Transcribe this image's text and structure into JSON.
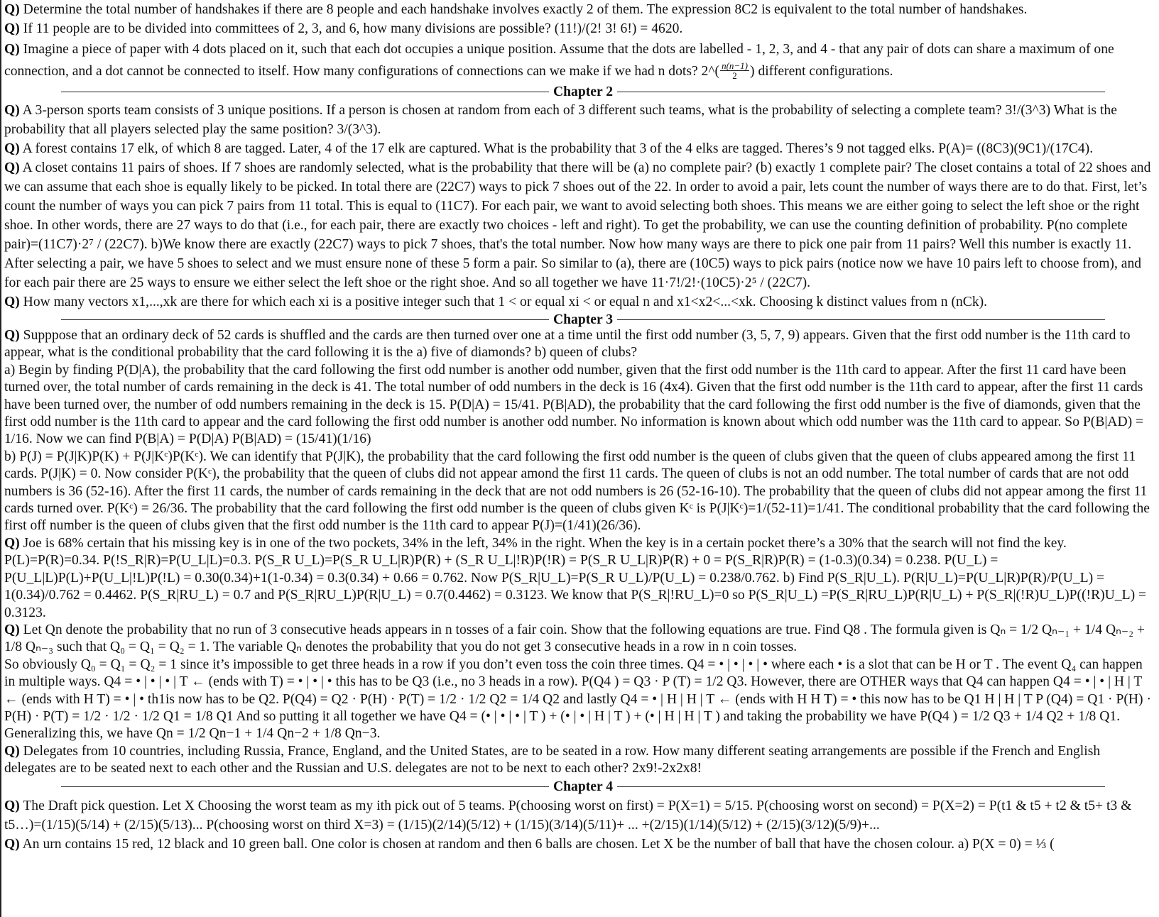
{
  "q_marker": "Q)",
  "items": {
    "q1": "Determine the total number of handshakes if there are 8 people and each handshake involves exactly 2 of them. The expression 8C2 is equivalent to the total number of handshakes.",
    "q2": "If 11 people are to be divided into committees of 2, 3, and 6, how many divisions are possible? (11!)/(2! 3! 6!) = 4620.",
    "q3a": "Imagine a piece of paper with 4 dots placed on it, such that each dot occupies a unique position. Assume that the dots are labelled - 1, 2, 3, and 4 - that any pair of dots can share a maximum of one connection, and a dot cannot be connected to itself. How many configurations of connections can we make if we had n dots? 2^(",
    "q3_frac_num": "n(n−1)",
    "q3_frac_den": "2",
    "q3b": ") different configurations.",
    "ch2": "Chapter 2",
    "q4": "A 3-person sports team consists of 3 unique positions. If a person is chosen at random from each of 3 different such teams, what is the probability of selecting a complete team? 3!/(3^3) What is the probability that all  players selected play the same position? 3/(3^3).",
    "q5": "A forest contains 17 elk, of which 8 are tagged. Later, 4 of the 17 elk are captured. What is the probability that 3 of the 4 elks are tagged. Theres’s 9 not tagged elks. P(A)= ((8C3)(9C1)/(17C4).",
    "q6": "A closet contains 11 pairs of shoes. If 7 shoes are randomly selected, what is the probability that there will be (a) no complete pair? (b) exactly 1 complete pair? The closet contains a total of 22 shoes and we can assume that each shoe is equally likely to be picked. In total there are (22C7) ways to pick 7 shoes out of the 22. In order to avoid a pair, lets count the number of ways there are to do that. First, let’s count the number of ways you can pick 7 pairs from 11 total. This is equal to (11C7). For each pair, we want to avoid selecting both shoes. This means we are either going to select the left shoe or the right shoe. In other words, there are 27 ways to do that (i.e., for each pair, there are exactly two choices - left and right). To get the probability, we can use the counting definition of probability. P(no complete pair)=(11C7)·2⁷ / (22C7). b)We know there are exactly (22C7) ways to pick 7 shoes, that's the total number. Now how many ways are there to pick one pair from 11 pairs? Well this number is exactly 11. After selecting a pair, we have 5 shoes to select and we must ensure none of these 5 form a pair. So similar to (a), there are (10C5) ways to pick pairs (notice now we have 10 pairs left to choose from), and for each pair there are 25 ways to ensure we either select the left shoe or the right shoe. And so all together we have 11·7!/2!·(10C5)·2⁵ / (22C7).",
    "q7": "How many vectors x1,...,xk are there for which each xi is a positive integer such that 1 < or equal xi < or equal n and x1<x2<...<xk. Choosing k distinct values from n (nCk).",
    "ch3": "Chapter 3",
    "q8": "Supppose that an ordinary deck of 52 cards is shuffled and the cards are then turned over one at a time until the first odd number (3, 5, 7, 9) appears. Given that the first odd number is the 11th card to appear, what is the conditional probability that the card following it is the a) five of diamonds? b) queen of clubs?",
    "q8a": "a) Begin by finding P(D|A), the probability that the card following the first odd number is another odd number, given that the first odd number is the 11th card to appear. After the first 11 card have been turned over, the total number of cards remaining in the deck is 41. The total number of odd numbers in the deck is 16 (4x4). Given that the first odd number is the 11th card to appear, after the first 11 cards have been turned over, the number of odd numbers remaining in the deck is 15. P(D|A) = 15/41. P(B|AD), the probability that the card following the first odd number is the five of diamonds, given that the first odd number is the 11th card to appear and the card following the first odd number is another odd number. No information is known about which odd number was the 11th card to appear. So P(B|AD) = 1/16. Now we can find P(B|A) = P(D|A) P(B|AD) = (15/41)(1/16)",
    "q8b": "b) P(J) = P(J|K)P(K) + P(J|Kᶜ)P(Kᶜ). We can identify that P(J|K), the probability that the card following the first odd number is the queen of clubs given that the queen of clubs appeared among the first 11 cards. P(J|K) = 0. Now consider P(Kᶜ), the probability that the queen of clubs did not appear amond the first 11 cards. The queen of clubs is not an odd number. The total number of cards that are not odd numbers is 36 (52-16). After the first 11 cards, the number of cards remaining in the deck that are not odd numbers is 26 (52-16-10). The probability that the queen of clubs did not appear among the first 11 cards turned over. P(Kᶜ) = 26/36. The probability that the card following the first odd number is the queen of clubs given Kᶜ is P(J|Kᶜ)=1/(52-11)=1/41. The conditional probability that the card following the first off number is the queen of clubs given that the first odd number is the 11th card to appear P(J)=(1/41)(26/36).",
    "q9": "Joe is 68% certain that his missing key is in one of the two pockets, 34% in the left, 34% in the right. When the key is in a certain pocket there’s a 30% that the search will not find the key. P(L)=P(R)=0.34. P(!S_R|R)=P(U_L|L)=0.3. P(S_R U_L)=P(S_R U_L|R)P(R) + (S_R U_L|!R)P(!R) = P(S_R U_L|R)P(R) + 0 = P(S_R|R)P(R) = (1-0.3)(0.34) = 0.238. P(U_L) = P(U_L|L)P(L)+P(U_L|!L)P(!L) = 0.30(0.34)+1(1-0.34) = 0.3(0.34) + 0.66 = 0.762. Now P(S_R|U_L)=P(S_R U_L)/P(U_L) = 0.238/0.762. b) Find P(S_R|U_L). P(R|U_L)=P(U_L|R)P(R)/P(U_L) = 1(0.34)/0.762 = 0.4462. P(S_R|RU_L) = 0.7 and P(S_R|RU_L)P(R|U_L) = 0.7(0.4462) = 0.3123. We know that P(S_R|!RU_L)=0 so P(S_R|U_L) =P(S_R|RU_L)P(R|U_L) + P(S_R|(!R)U_L)P((!R)U_L) = 0.3123.",
    "q10": "Let Qn denote the probability that no run of 3 consecutive heads appears in n tosses of a fair coin. Show that the following equations are true. Find Q8 . The formula given is Qₙ = 1/2 Qₙ₋₁ + 1/4 Qₙ₋₂ + 1/8 Qₙ₋₃ such that Q₀ = Q₁ = Q₂ = 1. The variable Qₙ denotes the probability that you do not get 3 consecutive heads in a row in n coin tosses.",
    "q10b": "So obviously Q₀ = Q₁ = Q₂ = 1 since it’s impossible to get three heads in a row if you don’t even toss the coin three times. Q4 = • | • | • | • where each • is a slot that can be H or T . The event Q₄ can happen in multiple ways. Q4 = • | • | • | T ← (ends with T) = • | • | •  this has to be Q3 (i.e., no 3 heads in a row). P(Q4 ) = Q3 · P (T) = 1/2 Q3. However, there are OTHER ways that Q4 can happen Q4 = • | • | H | T ← (ends with H T) = • | •  th1is now has to be Q2. P(Q4) = Q2 · P(H) · P(T) = 1/2 · 1/2 Q2 = 1/4 Q2 and lastly Q4 = • | H | H | T ← (ends with H H T) = • this now has to be Q1 H | H | T P (Q4) = Q1 · P(H) · P(H) · P(T) = 1/2 · 1/2 · 1/2 Q1 = 1/8 Q1 And so putting it all together we have Q4 = (• | • | • | T ) + (• | • | H | T ) + (• | H | H | T ) and taking the probability we have P(Q4 ) = 1/2 Q3 + 1/4 Q2 + 1/8 Q1. Generalizing this, we have Qn = 1/2 Qn−1 + 1/4 Qn−2 + 1/8 Qn−3.",
    "q11": "Delegates from 10 countries, including Russia, France, England, and the United States, are to be seated in a row. How many different seating arrangements are possible if the French and English delegates are to be seated next to each other and the Russian and U.S. delegates are not to be next to each other? 2x9!-2x2x8!",
    "ch4": "Chapter 4",
    "q12": "The Draft pick question. Let X Choosing the worst team as my ith pick out of 5 teams. P(choosing worst on first) = P(X=1) = 5/15. P(choosing worst on second) = P(X=2) = P(t1 & t5 + t2 & t5+ t3 & t5…)=(1/15)(5/14) + (2/15)(5/13)... P(choosing worst on third X=3) = (1/15)(2/14)(5/12) + (1/15)(3/14)(5/11)+ ... +(2/15)(1/14)(5/12) + (2/15)(3/12)(5/9)+...",
    "q13": "An urn contains 15 red, 12 black and 10 green ball. One color is chosen at random and then 6 balls are chosen. Let X be the number of ball that have the chosen colour. a) P(X = 0) = ⅓ ("
  }
}
